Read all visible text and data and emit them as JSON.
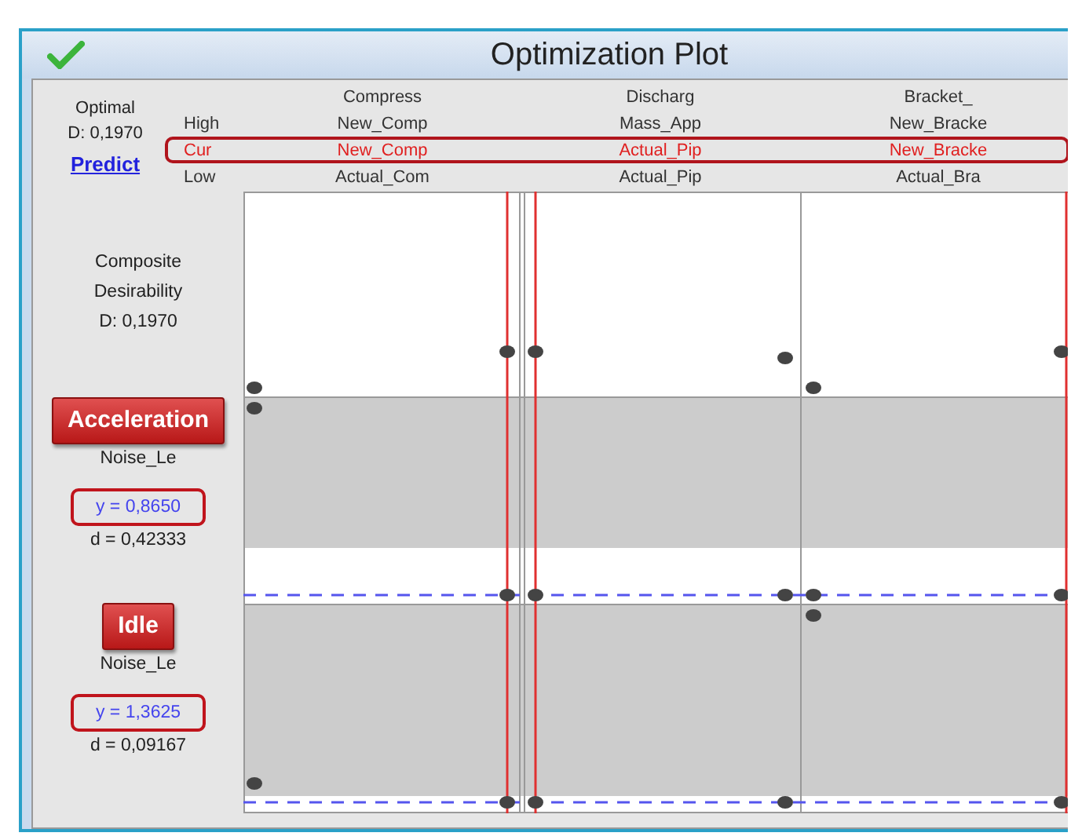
{
  "window": {
    "title": "Optimization Plot"
  },
  "optimal": {
    "label": "Optimal",
    "value": "D: 0,1970",
    "link": "Predict"
  },
  "row_labels": [
    {
      "kind": "high",
      "text": "High"
    },
    {
      "kind": "current",
      "text": "Cur"
    },
    {
      "kind": "low",
      "text": "Low"
    }
  ],
  "current_row_highlighted": true,
  "factors": [
    {
      "name": "Compress",
      "high": "New_Comp",
      "current": "New_Comp",
      "low": "Actual_Com"
    },
    {
      "name": "Discharg",
      "high": "Mass_App",
      "current": "Actual_Pip",
      "low": "Actual_Pip"
    },
    {
      "name": "Bracket_",
      "high": "New_Bracke",
      "current": "New_Bracke",
      "low": "Actual_Bra"
    }
  ],
  "composite": {
    "lines": [
      "Composite",
      "Desirability",
      "D: 0,1970"
    ]
  },
  "responses": [
    {
      "goal": "Acceleration",
      "name": "Noise_Le",
      "y": "y = 0,8650",
      "d": "d = 0,42333",
      "highlighted": true
    },
    {
      "goal": "Idle",
      "name": "Noise_Le",
      "y": "y = 1,3625",
      "d": "d = 0,09167",
      "highlighted": true
    }
  ]
}
